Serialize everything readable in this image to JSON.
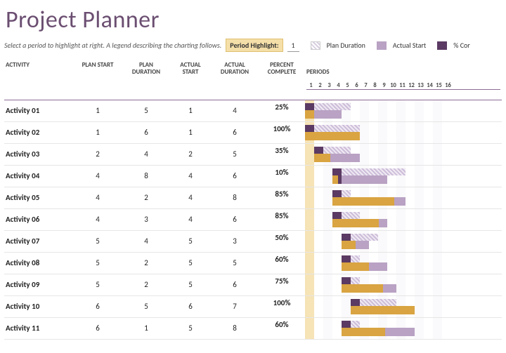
{
  "title": "Project Planner",
  "hint": "Select a period to highlight at right.  A legend describing the charting follows.",
  "period_highlight_label": "Period Highlight:",
  "period_highlight_value": "1",
  "legend": {
    "plan": "Plan Duration",
    "actual": "Actual Start",
    "pct": "% Cor"
  },
  "columns": {
    "activity": "ACTIVITY",
    "plan_start": "PLAN START",
    "plan_duration": "PLAN\nDURATION",
    "actual_start": "ACTUAL\nSTART",
    "actual_duration": "ACTUAL\nDURATION",
    "percent_complete": "PERCENT\nCOMPLETE",
    "periods": "PERIODS"
  },
  "periods": [
    "1",
    "2",
    "3",
    "4",
    "5",
    "6",
    "7",
    "8",
    "9",
    "10",
    "11",
    "12",
    "13",
    "14",
    "15",
    "16"
  ],
  "highlight_period": 1,
  "rows": [
    {
      "activity": "Activity 01",
      "plan_start": 1,
      "plan_duration": 5,
      "actual_start": 1,
      "actual_duration": 4,
      "percent": "25%",
      "pct_num": 25
    },
    {
      "activity": "Activity 02",
      "plan_start": 1,
      "plan_duration": 6,
      "actual_start": 1,
      "actual_duration": 6,
      "percent": "100%",
      "pct_num": 100
    },
    {
      "activity": "Activity 03",
      "plan_start": 2,
      "plan_duration": 4,
      "actual_start": 2,
      "actual_duration": 5,
      "percent": "35%",
      "pct_num": 35
    },
    {
      "activity": "Activity 04",
      "plan_start": 4,
      "plan_duration": 8,
      "actual_start": 4,
      "actual_duration": 6,
      "percent": "10%",
      "pct_num": 10
    },
    {
      "activity": "Activity 05",
      "plan_start": 4,
      "plan_duration": 2,
      "actual_start": 4,
      "actual_duration": 8,
      "percent": "85%",
      "pct_num": 85
    },
    {
      "activity": "Activity 06",
      "plan_start": 4,
      "plan_duration": 3,
      "actual_start": 4,
      "actual_duration": 6,
      "percent": "85%",
      "pct_num": 85
    },
    {
      "activity": "Activity 07",
      "plan_start": 5,
      "plan_duration": 4,
      "actual_start": 5,
      "actual_duration": 3,
      "percent": "50%",
      "pct_num": 50
    },
    {
      "activity": "Activity 08",
      "plan_start": 5,
      "plan_duration": 2,
      "actual_start": 5,
      "actual_duration": 5,
      "percent": "60%",
      "pct_num": 60
    },
    {
      "activity": "Activity 09",
      "plan_start": 5,
      "plan_duration": 2,
      "actual_start": 5,
      "actual_duration": 6,
      "percent": "75%",
      "pct_num": 75
    },
    {
      "activity": "Activity 10",
      "plan_start": 6,
      "plan_duration": 5,
      "actual_start": 6,
      "actual_duration": 7,
      "percent": "100%",
      "pct_num": 100
    },
    {
      "activity": "Activity 11",
      "plan_start": 6,
      "plan_duration": 1,
      "actual_start": 5,
      "actual_duration": 8,
      "percent": "60%",
      "pct_num": 60
    }
  ],
  "chart_data": {
    "type": "table",
    "title": "Project Planner Gantt",
    "x": [
      1,
      2,
      3,
      4,
      5,
      6,
      7,
      8,
      9,
      10,
      11,
      12,
      13,
      14,
      15,
      16
    ],
    "series": [
      {
        "name": "Activity 01",
        "plan": [
          1,
          5
        ],
        "actual": [
          1,
          4
        ],
        "percent_complete": 25
      },
      {
        "name": "Activity 02",
        "plan": [
          1,
          6
        ],
        "actual": [
          1,
          6
        ],
        "percent_complete": 100
      },
      {
        "name": "Activity 03",
        "plan": [
          2,
          4
        ],
        "actual": [
          2,
          5
        ],
        "percent_complete": 35
      },
      {
        "name": "Activity 04",
        "plan": [
          4,
          8
        ],
        "actual": [
          4,
          6
        ],
        "percent_complete": 10
      },
      {
        "name": "Activity 05",
        "plan": [
          4,
          2
        ],
        "actual": [
          4,
          8
        ],
        "percent_complete": 85
      },
      {
        "name": "Activity 06",
        "plan": [
          4,
          3
        ],
        "actual": [
          4,
          6
        ],
        "percent_complete": 85
      },
      {
        "name": "Activity 07",
        "plan": [
          5,
          4
        ],
        "actual": [
          5,
          3
        ],
        "percent_complete": 50
      },
      {
        "name": "Activity 08",
        "plan": [
          5,
          2
        ],
        "actual": [
          5,
          5
        ],
        "percent_complete": 60
      },
      {
        "name": "Activity 09",
        "plan": [
          5,
          2
        ],
        "actual": [
          5,
          6
        ],
        "percent_complete": 75
      },
      {
        "name": "Activity 10",
        "plan": [
          6,
          5
        ],
        "actual": [
          6,
          7
        ],
        "percent_complete": 100
      },
      {
        "name": "Activity 11",
        "plan": [
          6,
          1
        ],
        "actual": [
          5,
          8
        ],
        "percent_complete": 60
      }
    ]
  }
}
